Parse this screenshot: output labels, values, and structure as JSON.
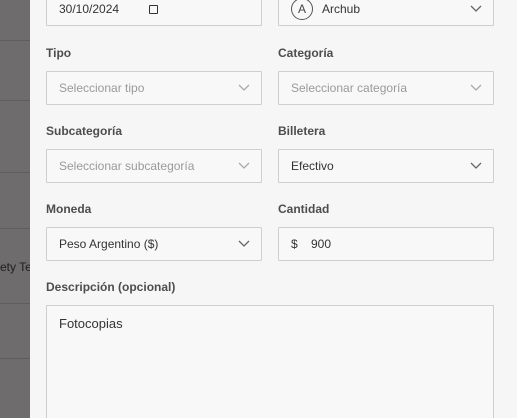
{
  "background": {
    "partial_text": "ety Tes"
  },
  "form": {
    "date": {
      "value": "30/10/2024"
    },
    "creator": {
      "avatar_initial": "A",
      "value": "Archub"
    },
    "tipo": {
      "label": "Tipo",
      "placeholder": "Seleccionar tipo"
    },
    "categoria": {
      "label": "Categoría",
      "placeholder": "Seleccionar categoría"
    },
    "subcategoria": {
      "label": "Subcategoría",
      "placeholder": "Seleccionar subcategoría"
    },
    "billetera": {
      "label": "Billetera",
      "value": "Efectivo"
    },
    "moneda": {
      "label": "Moneda",
      "value": "Peso Argentino ($)"
    },
    "cantidad": {
      "label": "Cantidad",
      "currency_symbol": "$",
      "value": "900"
    },
    "descripcion": {
      "label": "Descripción (opcional)",
      "value": "Fotocopias"
    }
  },
  "icons": {
    "select_chevron": "chevron-down-icon",
    "calendar": "calendar-icon"
  }
}
